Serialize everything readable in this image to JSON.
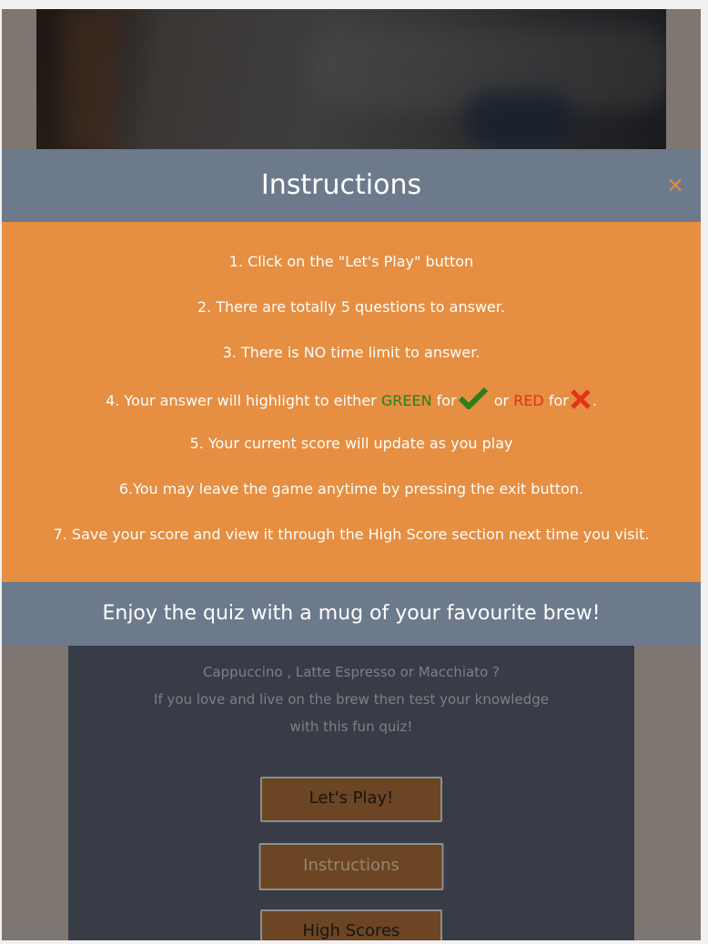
{
  "modal": {
    "title": "Instructions",
    "close_label": "×",
    "steps": [
      "1. Click on the \"Let's Play\" button",
      "2. There are totally 5 questions to answer.",
      "3. There is NO time limit to answer.",
      {
        "before": "4. Your answer will highlight to either",
        "green_word": "GREEN",
        "for1": "for",
        "or": "or",
        "red_word": "RED",
        "for2": "for",
        "end": "."
      },
      "5. Your current score will update as you play",
      "6.You may leave the game anytime by pressing the exit button.",
      "7. Save your score and view it through the High Score section next time you visit."
    ],
    "footer": "Enjoy the quiz with a mug of your favourite brew!"
  },
  "intro": {
    "line1": "Cappuccino , Latte Espresso or Macchiato ?",
    "line2": "If you love and live on the brew then test your knowledge",
    "line3": "with this fun quiz!"
  },
  "menu": {
    "play_label": "Let's Play!",
    "instructions_label": "Instructions",
    "highscores_label": "High Scores"
  },
  "icons": {
    "correct": "check-icon",
    "wrong": "cross-icon"
  },
  "colors": {
    "header": "#6d7a8c",
    "body": "#e68e41",
    "green": "#2e7d1f",
    "red": "#e3331a",
    "close": "#e88b3c"
  }
}
